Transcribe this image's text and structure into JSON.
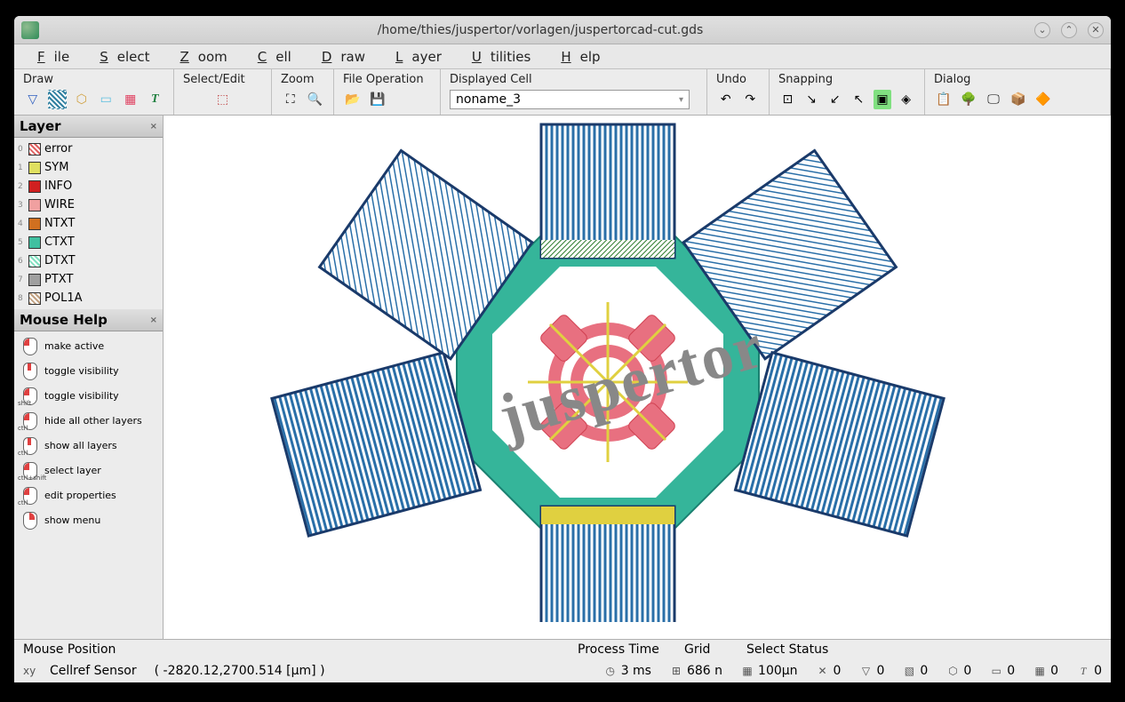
{
  "window": {
    "title": "/home/thies/juspertor/vorlagen/juspertorcad-cut.gds"
  },
  "menubar": [
    "File",
    "Select",
    "Zoom",
    "Cell",
    "Draw",
    "Layer",
    "Utilities",
    "Help"
  ],
  "toolbar": {
    "draw_label": "Draw",
    "select_label": "Select/Edit",
    "zoom_label": "Zoom",
    "fileop_label": "File Operation",
    "displayed_cell_label": "Displayed Cell",
    "cell_value": "noname_3",
    "undo_label": "Undo",
    "snapping_label": "Snapping",
    "dialog_label": "Dialog"
  },
  "layer_panel": {
    "title": "Layer",
    "items": [
      {
        "idx": "0",
        "name": "error",
        "color": "#e06060",
        "pattern": "hatch"
      },
      {
        "idx": "1",
        "name": "SYM",
        "color": "#e0e060",
        "pattern": "solid"
      },
      {
        "idx": "2",
        "name": "INFO",
        "color": "#d02020",
        "pattern": "solid"
      },
      {
        "idx": "3",
        "name": "WIRE",
        "color": "#f0a0a0",
        "pattern": "solid"
      },
      {
        "idx": "4",
        "name": "NTXT",
        "color": "#d07020",
        "pattern": "solid"
      },
      {
        "idx": "5",
        "name": "CTXT",
        "color": "#40c0a0",
        "pattern": "solid"
      },
      {
        "idx": "6",
        "name": "DTXT",
        "color": "#80e0c0",
        "pattern": "hatch"
      },
      {
        "idx": "7",
        "name": "PTXT",
        "color": "#a0a0a0",
        "pattern": "solid"
      },
      {
        "idx": "8",
        "name": "POL1A",
        "color": "#c0a080",
        "pattern": "hatch"
      }
    ]
  },
  "mouse_help": {
    "title": "Mouse Help",
    "items": [
      {
        "btn": "left",
        "mod": "",
        "label": "make active"
      },
      {
        "btn": "mid",
        "mod": "",
        "label": "toggle visibility"
      },
      {
        "btn": "left",
        "mod": "shift",
        "label": "toggle visibility"
      },
      {
        "btn": "left",
        "mod": "ctrl",
        "label": "hide all other layers"
      },
      {
        "btn": "mid",
        "mod": "ctrl",
        "label": "show all layers"
      },
      {
        "btn": "left",
        "mod": "ctrl+shift",
        "label": "select layer"
      },
      {
        "btn": "left",
        "mod": "ctrl",
        "label": "edit properties"
      },
      {
        "btn": "right",
        "mod": "",
        "label": "show menu"
      }
    ]
  },
  "status": {
    "mouse_pos_label": "Mouse Position",
    "mouse_pos_prefix": "Cellref Sensor",
    "mouse_pos_value": "( -2820.12,2700.514 [µm] )",
    "process_time_label": "Process Time",
    "process_time_value": "3 ms",
    "grid_label": "Grid",
    "grid_value1": "686 n",
    "grid_value2": "100µn",
    "select_status_label": "Select Status",
    "sel_points": "0",
    "sel_paths": "0",
    "sel_boxes": "0",
    "sel_polys": "0",
    "sel_cells": "0",
    "sel_arrays": "0",
    "sel_text": "0"
  },
  "watermark": "juspertor"
}
